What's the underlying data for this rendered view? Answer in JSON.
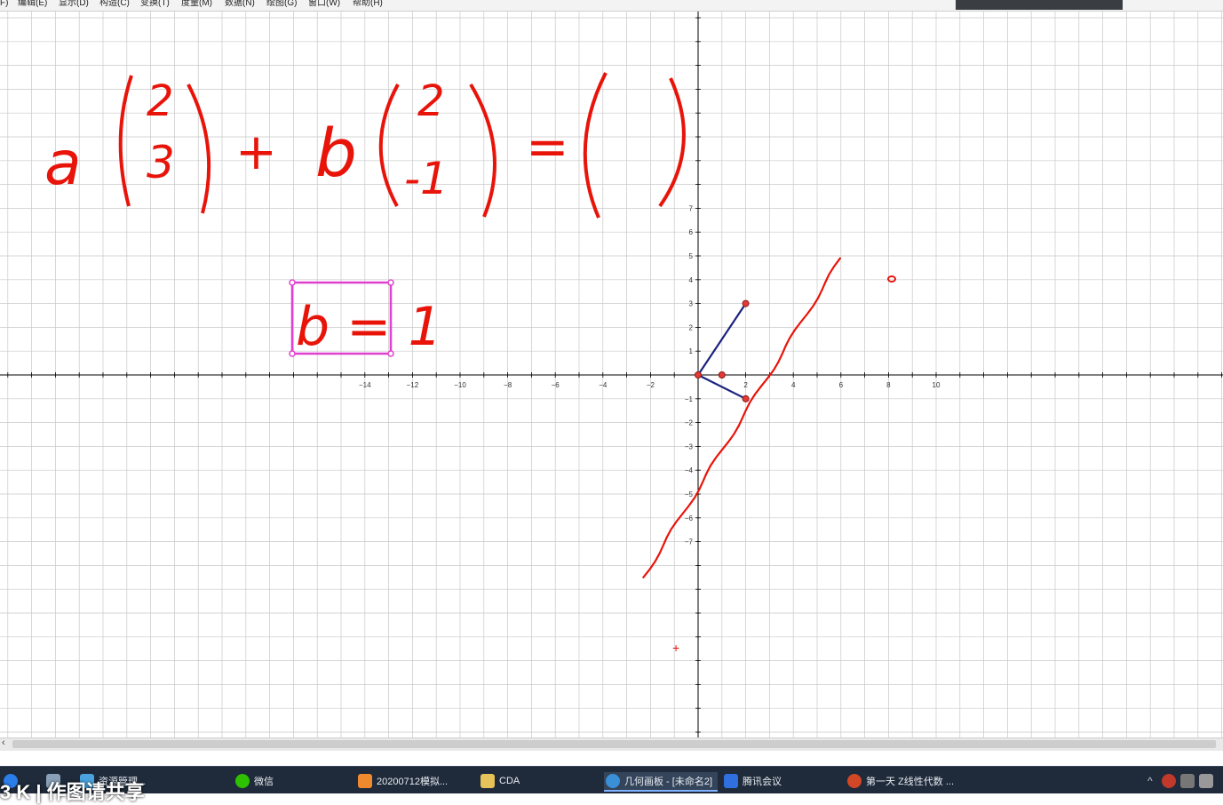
{
  "menu": [
    "F)",
    "编辑(E)",
    "显示(D)",
    "构造(C)",
    "变换(T)",
    "度量(M)",
    "数据(N)",
    "绘图(G)",
    "窗口(W)",
    "帮助(H)"
  ],
  "graph": {
    "x_ticks": [
      "-14",
      "-12",
      "-10",
      "-8",
      "-6",
      "-4",
      "-2",
      "2",
      "4",
      "6",
      "8",
      "10"
    ],
    "y_ticks": [
      "7",
      "6",
      "5",
      "4",
      "3",
      "2",
      "1",
      "-1",
      "-2",
      "-3",
      "-4",
      "-5",
      "-6",
      "-7"
    ],
    "points": [
      {
        "label": "origin",
        "x": 0,
        "y": 0
      },
      {
        "label": "unit point",
        "x": 1,
        "y": 0
      },
      {
        "label": "vector (2,3) tip",
        "x": 2,
        "y": 3
      },
      {
        "label": "vector (2,-1) tip",
        "x": 2,
        "y": -1
      }
    ],
    "vectors": [
      {
        "from": [
          0,
          0
        ],
        "to": [
          2,
          3
        ]
      },
      {
        "from": [
          0,
          0
        ],
        "to": [
          2,
          -1
        ]
      }
    ],
    "ink_line": {
      "from": [
        -2.3,
        -8.5
      ],
      "to": [
        6,
        4.9
      ]
    },
    "colors": {
      "grid": "#c8c8c8",
      "axis": "#000000",
      "vector": "#1a237e",
      "ink": "#e8140a",
      "box": "#e040d0"
    }
  },
  "handwriting": {
    "equation": {
      "coef_a": "a",
      "vec1_top": "2",
      "vec1_bottom": "3",
      "plus": "+",
      "coef_b": "b",
      "vec2_top": "2",
      "vec2_bottom": "-1",
      "equals": "="
    },
    "boxed_note": "b = 1"
  },
  "taskbar": {
    "items": [
      "资源管理...",
      "微信",
      "20200712模拟...",
      "CDA",
      "几何画板 - [未命名2]",
      "腾讯会议",
      "第一天 Z线性代数 ..."
    ]
  },
  "caption": "3 K | 作图请共享"
}
